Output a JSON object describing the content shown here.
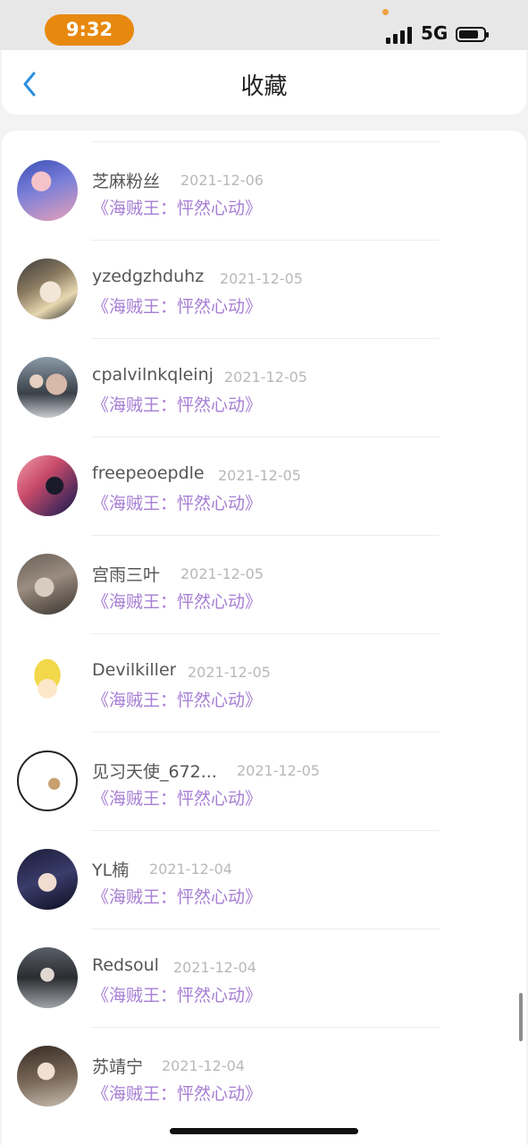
{
  "status_bar": {
    "time": "9:32",
    "network": "5G"
  },
  "header": {
    "title": "收藏",
    "back_icon": "chevron-left-icon"
  },
  "colors": {
    "time_pill": "#e8890f",
    "accent_link": "#a67ed4",
    "back_icon": "#2a8fe0"
  },
  "items": [
    {
      "name": "芝麻粉丝",
      "date": "2021-12-06",
      "title": "《海贼王：怦然心动》"
    },
    {
      "name": "yzedgzhduhz",
      "date": "2021-12-05",
      "title": "《海贼王：怦然心动》"
    },
    {
      "name": "cpalvilnkqleinj",
      "date": "2021-12-05",
      "title": "《海贼王：怦然心动》"
    },
    {
      "name": "freepeoepdle",
      "date": "2021-12-05",
      "title": "《海贼王：怦然心动》"
    },
    {
      "name": "宫雨三叶",
      "date": "2021-12-05",
      "title": "《海贼王：怦然心动》"
    },
    {
      "name": "Devilkiller",
      "date": "2021-12-05",
      "title": "《海贼王：怦然心动》"
    },
    {
      "name": "见习天使_672...",
      "date": "2021-12-05",
      "title": "《海贼王：怦然心动》"
    },
    {
      "name": "YL楠",
      "date": "2021-12-04",
      "title": "《海贼王：怦然心动》"
    },
    {
      "name": "Redsoul",
      "date": "2021-12-04",
      "title": "《海贼王：怦然心动》"
    },
    {
      "name": "苏靖宁",
      "date": "2021-12-04",
      "title": "《海贼王：怦然心动》"
    }
  ]
}
